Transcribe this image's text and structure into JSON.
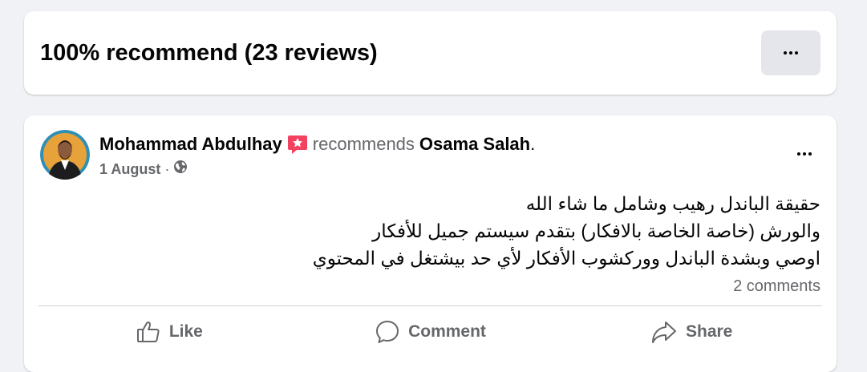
{
  "summary": {
    "title": "100% recommend (23 reviews)",
    "more_icon": "more-horizontal-icon"
  },
  "post": {
    "author": "Mohammad Abdulhay",
    "recommend_icon": "recommend-star-icon",
    "recommends_text": "recommends",
    "target": "Osama Salah",
    "period": ".",
    "date": "1 August",
    "separator": "·",
    "privacy_icon": "globe-icon",
    "more_icon": "more-horizontal-icon",
    "body_lines": [
      "حقيقة الباندل رهيب وشامل ما شاء الله",
      "والورش (خاصة الخاصة  بالافكار) بتقدم سيستم جميل للأفكار",
      "اوصي وبشدة الباندل ووركشوب الأفكار لأي حد بيشتغل في المحتوي"
    ],
    "comments_count": "2 comments",
    "actions": {
      "like": "Like",
      "comment": "Comment",
      "share": "Share"
    }
  },
  "colors": {
    "background": "#f0f2f5",
    "card": "#ffffff",
    "secondary_text": "#65676b",
    "button_gray": "#e4e6eb",
    "badge_pink": "#f3425f"
  }
}
